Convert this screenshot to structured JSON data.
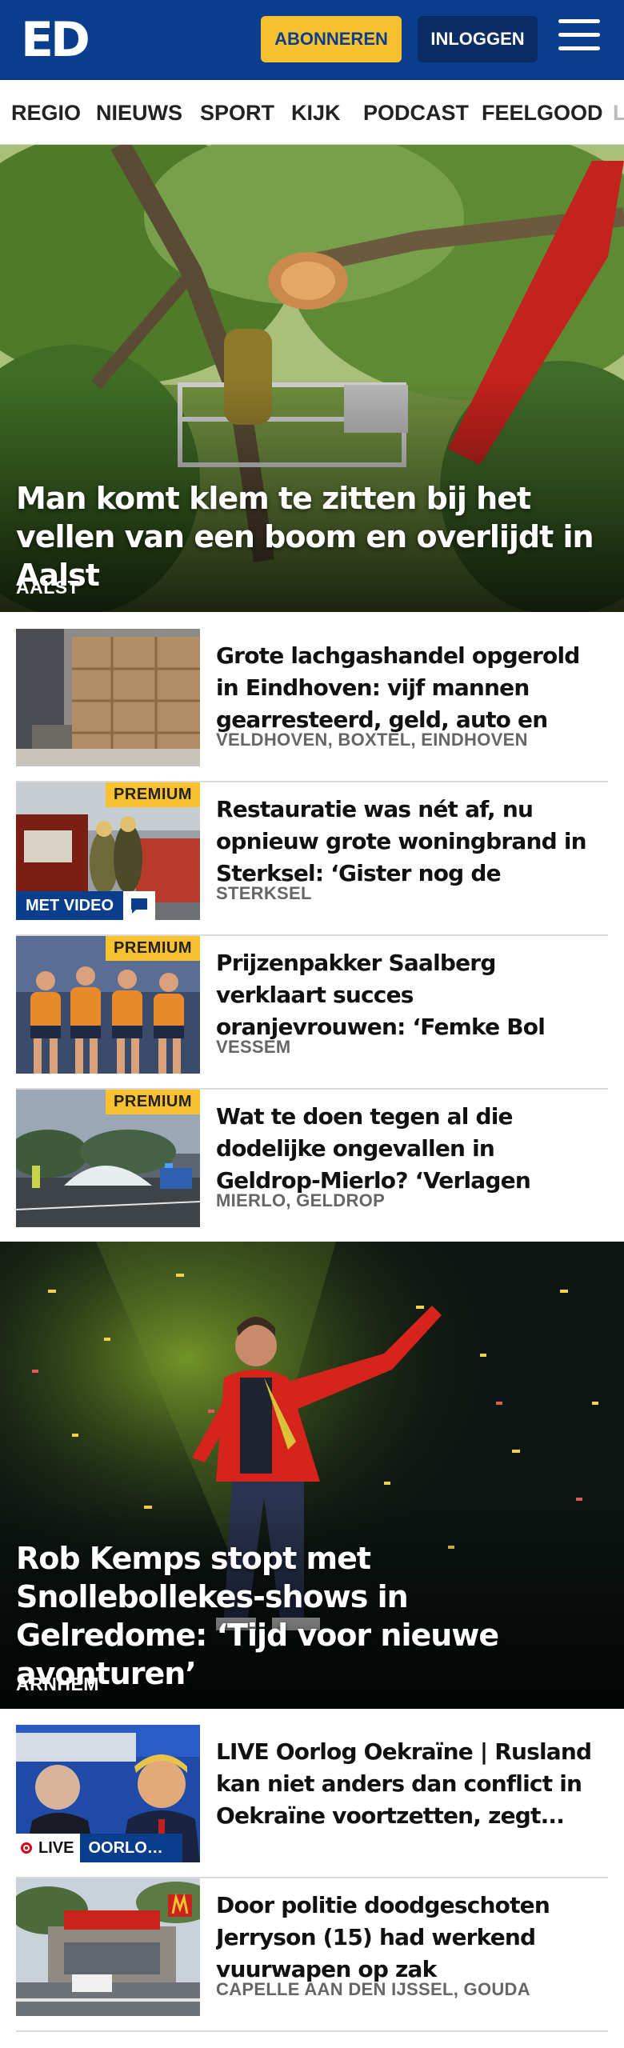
{
  "header": {
    "logo": "ED",
    "subscribe_label": "ABONNEREN",
    "login_label": "INLOGGEN",
    "colors": {
      "brand": "#0a3e8c",
      "accent": "#f9c12d"
    }
  },
  "nav": {
    "items": [
      {
        "label": "REGIO"
      },
      {
        "label": "NIEUWS"
      },
      {
        "label": "SPORT"
      },
      {
        "label": "KIJK"
      },
      {
        "label": "PODCAST"
      },
      {
        "label": "FEELGOOD"
      },
      {
        "label": "L"
      }
    ]
  },
  "hero1": {
    "title": "Man komt klem te zitten bij het vellen van een boom en overlijdt in Aalst",
    "location": "AALST"
  },
  "articles1": [
    {
      "title": "Grote lachgashandel opgerold in Eindhoven: vijf mannen gearres­teerd, geld, auto en dure...",
      "location": "VELDHOVEN, BOXTEL, EINDHOVEN"
    },
    {
      "title": "Restauratie was nét af, nu opnieuw grote woningbrand in Sterksel: ‘Gister nog de laatste...",
      "location": "STERKSEL",
      "badge": "PREMIUM",
      "video_badge": "MET VIDEO"
    },
    {
      "title": "Prijzenpakker Saalberg verklaart succes oranjevrouwen: ‘Femke Bol heeft ons net zo hard nodig...",
      "location": "VESSEM",
      "badge": "PREMIUM"
    },
    {
      "title": "Wat te doen tegen al die dodelijke ongevallen in Geldrop-Mierlo? ‘Verlagen maximumsne...",
      "location": "MIERLO, GELDROP",
      "badge": "PREMIUM"
    }
  ],
  "hero2": {
    "title": "Rob Kemps stopt met Snollebollekes-shows in Gelredome: ‘Tijd voor nieuwe avonturen’",
    "location": "ARNHEM"
  },
  "articles2": [
    {
      "title": "LIVE Oorlog Oekraïne | Rusland kan niet anders dan conflict in Oekraïne voortzetten, zegt...",
      "live_label": "LIVE",
      "live_tag": "OORLOG ..."
    },
    {
      "title": "Door politie doodgeschoten Jerryson (15) had werkend vuurwapen op zak",
      "location": "CAPELLE AAN DEN IJSSEL, GOUDA"
    }
  ],
  "icons": [
    "hamburger-menu-icon",
    "chat-bubble-icon",
    "live-dot-icon"
  ]
}
